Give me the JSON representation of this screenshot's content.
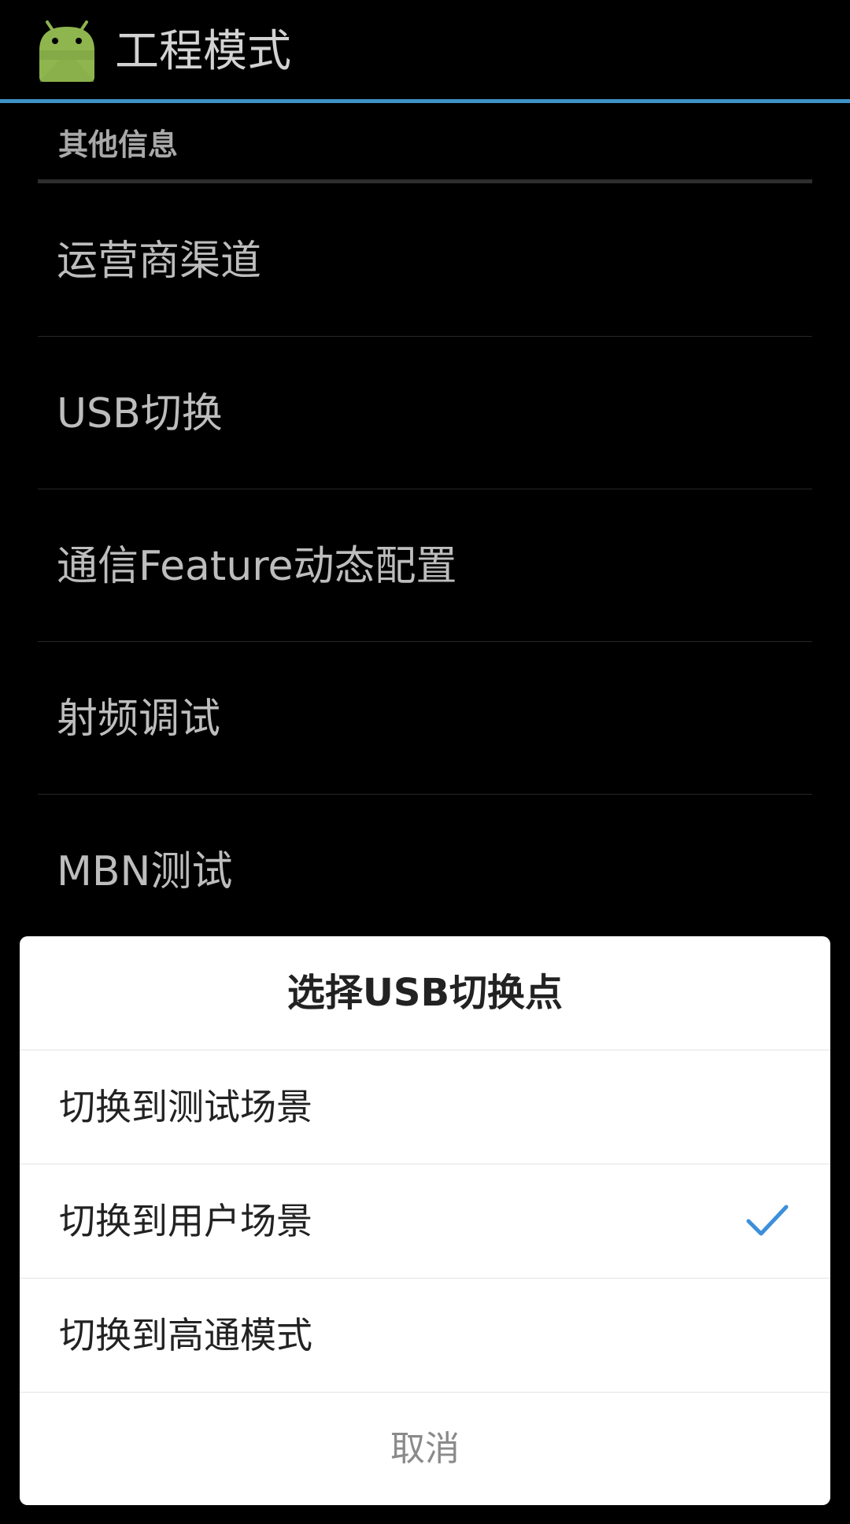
{
  "action_bar": {
    "icon": "android-icon",
    "title": "工程模式",
    "accent_color": "#3e92c6"
  },
  "category": {
    "label": "其他信息"
  },
  "list": {
    "items": [
      {
        "label": "运营商渠道"
      },
      {
        "label": "USB切换"
      },
      {
        "label": "通信Feature动态配置"
      },
      {
        "label": "射频调试"
      },
      {
        "label": "MBN测试"
      }
    ]
  },
  "dialog": {
    "title": "选择USB切换点",
    "options": [
      {
        "label": "切换到测试场景",
        "selected": false
      },
      {
        "label": "切换到用户场景",
        "selected": true
      },
      {
        "label": "切换到高通模式",
        "selected": false
      }
    ],
    "check_color": "#3d8fdb",
    "cancel_label": "取消"
  }
}
